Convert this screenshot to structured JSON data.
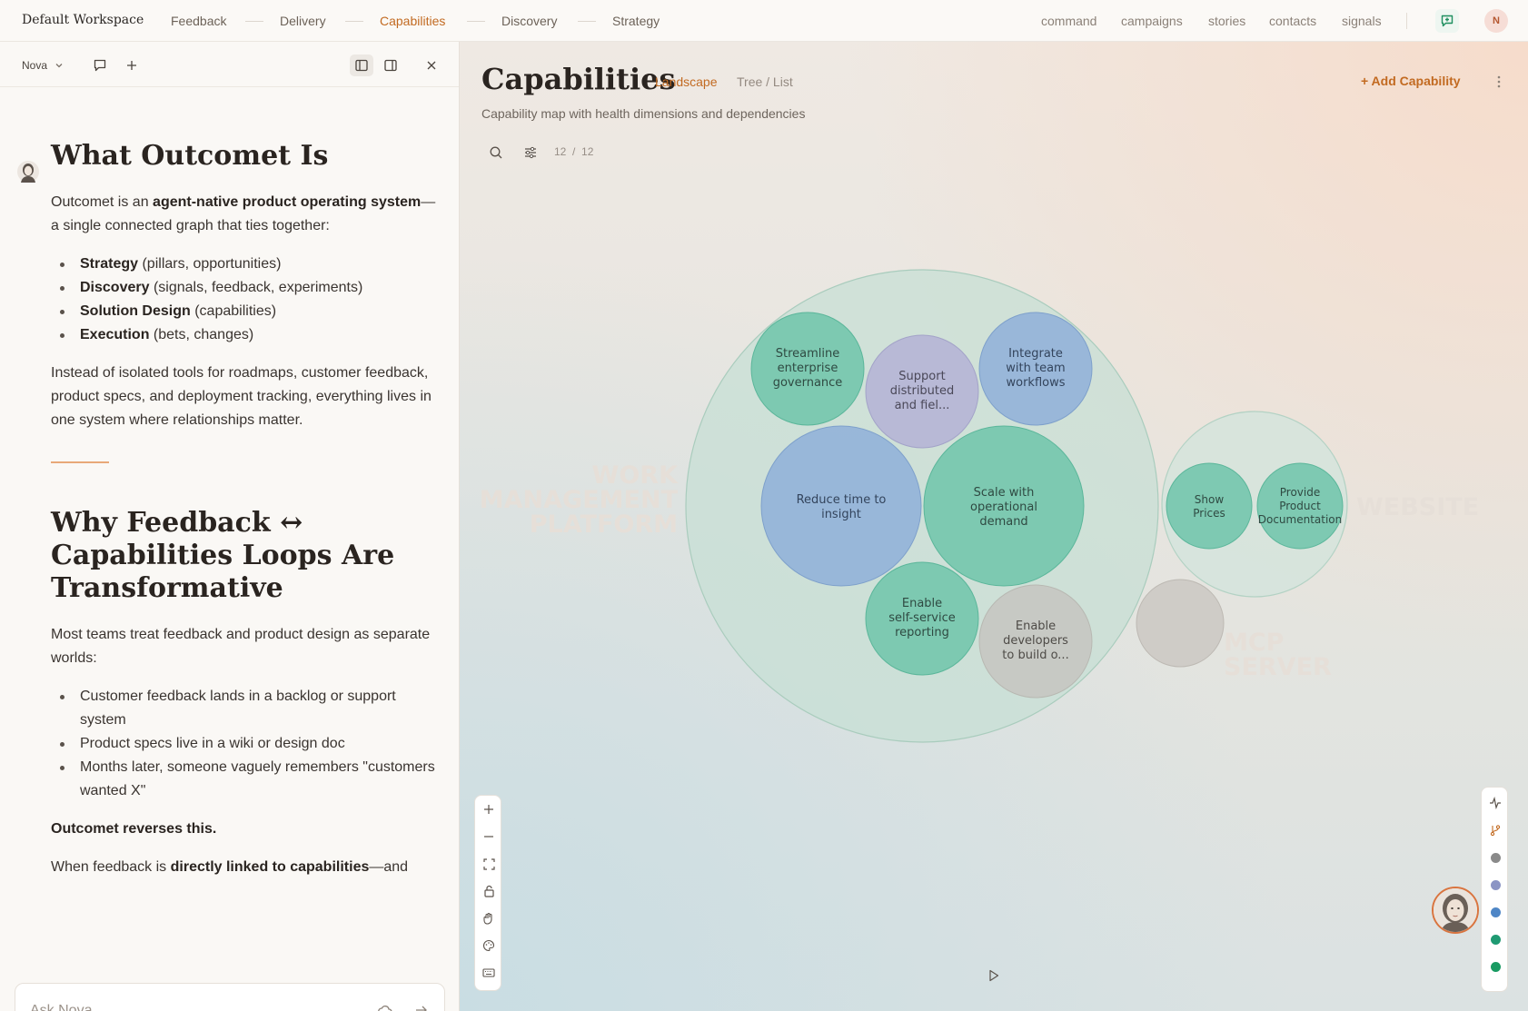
{
  "topbar": {
    "workspace": "Default Workspace",
    "nav": [
      "Feedback",
      "Delivery",
      "Capabilities",
      "Discovery",
      "Strategy"
    ],
    "links": [
      "command",
      "campaigns",
      "stories",
      "contacts",
      "signals"
    ],
    "avatar_initial": "N"
  },
  "left_panel": {
    "agent_name": "Nova",
    "section1": {
      "title": "What Outcomet Is",
      "intro_pre": "Outcomet is an ",
      "intro_bold": "agent-native product operating system",
      "intro_post": "—a single connected graph that ties together:",
      "items": [
        {
          "bold": "Strategy",
          "rest": " (pillars, opportunities)"
        },
        {
          "bold": "Discovery",
          "rest": " (signals, feedback, experiments)"
        },
        {
          "bold": "Solution Design",
          "rest": " (capabilities)"
        },
        {
          "bold": "Execution",
          "rest": " (bets, changes)"
        }
      ],
      "closing": "Instead of isolated tools for roadmaps, customer feedback, product specs, and deployment tracking, everything lives in one system where relationships matter."
    },
    "section2": {
      "title": "Why Feedback ↔ Capabilities Loops Are Transformative",
      "intro": "Most teams treat feedback and product design as separate worlds:",
      "items": [
        "Customer feedback lands in a backlog or support system",
        "Product specs live in a wiki or design doc",
        "Months later, someone vaguely remembers \"customers wanted X\""
      ],
      "reverse": "Outcomet reverses this.",
      "trail_pre": "When feedback is ",
      "trail_bold": "directly linked to capabilities",
      "trail_post": "—and"
    },
    "ask_placeholder": "Ask Nova..."
  },
  "main": {
    "title": "Capabilities",
    "view_active": "Landscape",
    "view_other": "Tree / List",
    "subtitle": "Capability map with health dimensions and dependencies",
    "add_label": "Add Capability",
    "count_shown": "12",
    "count_sep": "/",
    "count_total": "12"
  },
  "bubble_map": {
    "groups": [
      {
        "label_lines": [
          "WORK",
          "MANAGEMENT",
          "PLATFORM"
        ]
      },
      {
        "label_lines": [
          "WEBSITE"
        ]
      },
      {
        "label_lines": [
          "MCP",
          "SERVER"
        ]
      }
    ],
    "capabilities": [
      {
        "group": "WORK MANAGEMENT PLATFORM",
        "lines": [
          "Streamline",
          "enterprise",
          "governance"
        ],
        "color": "#6ec4aa"
      },
      {
        "group": "WORK MANAGEMENT PLATFORM",
        "lines": [
          "Support",
          "distributed",
          "and fiel..."
        ],
        "color": "#b5b5d6"
      },
      {
        "group": "WORK MANAGEMENT PLATFORM",
        "lines": [
          "Integrate",
          "with team",
          "workflows"
        ],
        "color": "#92b2d9"
      },
      {
        "group": "WORK MANAGEMENT PLATFORM",
        "lines": [
          "Reduce time to",
          "insight"
        ],
        "color": "#92b2d9"
      },
      {
        "group": "WORK MANAGEMENT PLATFORM",
        "lines": [
          "Scale with",
          "operational",
          "demand"
        ],
        "color": "#6ec4aa"
      },
      {
        "group": "WORK MANAGEMENT PLATFORM",
        "lines": [
          "Enable",
          "self-service",
          "reporting"
        ],
        "color": "#6ec4aa"
      },
      {
        "group": "WORK MANAGEMENT PLATFORM",
        "lines": [
          "Enable",
          "developers",
          "to build o..."
        ],
        "color": "#c7c7c2"
      },
      {
        "group": "WEBSITE",
        "lines": [
          "Show",
          "Prices"
        ],
        "color": "#6ec4aa"
      },
      {
        "group": "WEBSITE",
        "lines": [
          "Provide",
          "Product",
          "Documentation"
        ],
        "color": "#6ec4aa"
      },
      {
        "group": "MCP SERVER",
        "lines": [],
        "color": "#cbc8c3"
      }
    ]
  },
  "legend_colors": [
    "#8a8a8a",
    "#8b94c4",
    "#4f86c6",
    "#1f9a72",
    "#189a62"
  ]
}
